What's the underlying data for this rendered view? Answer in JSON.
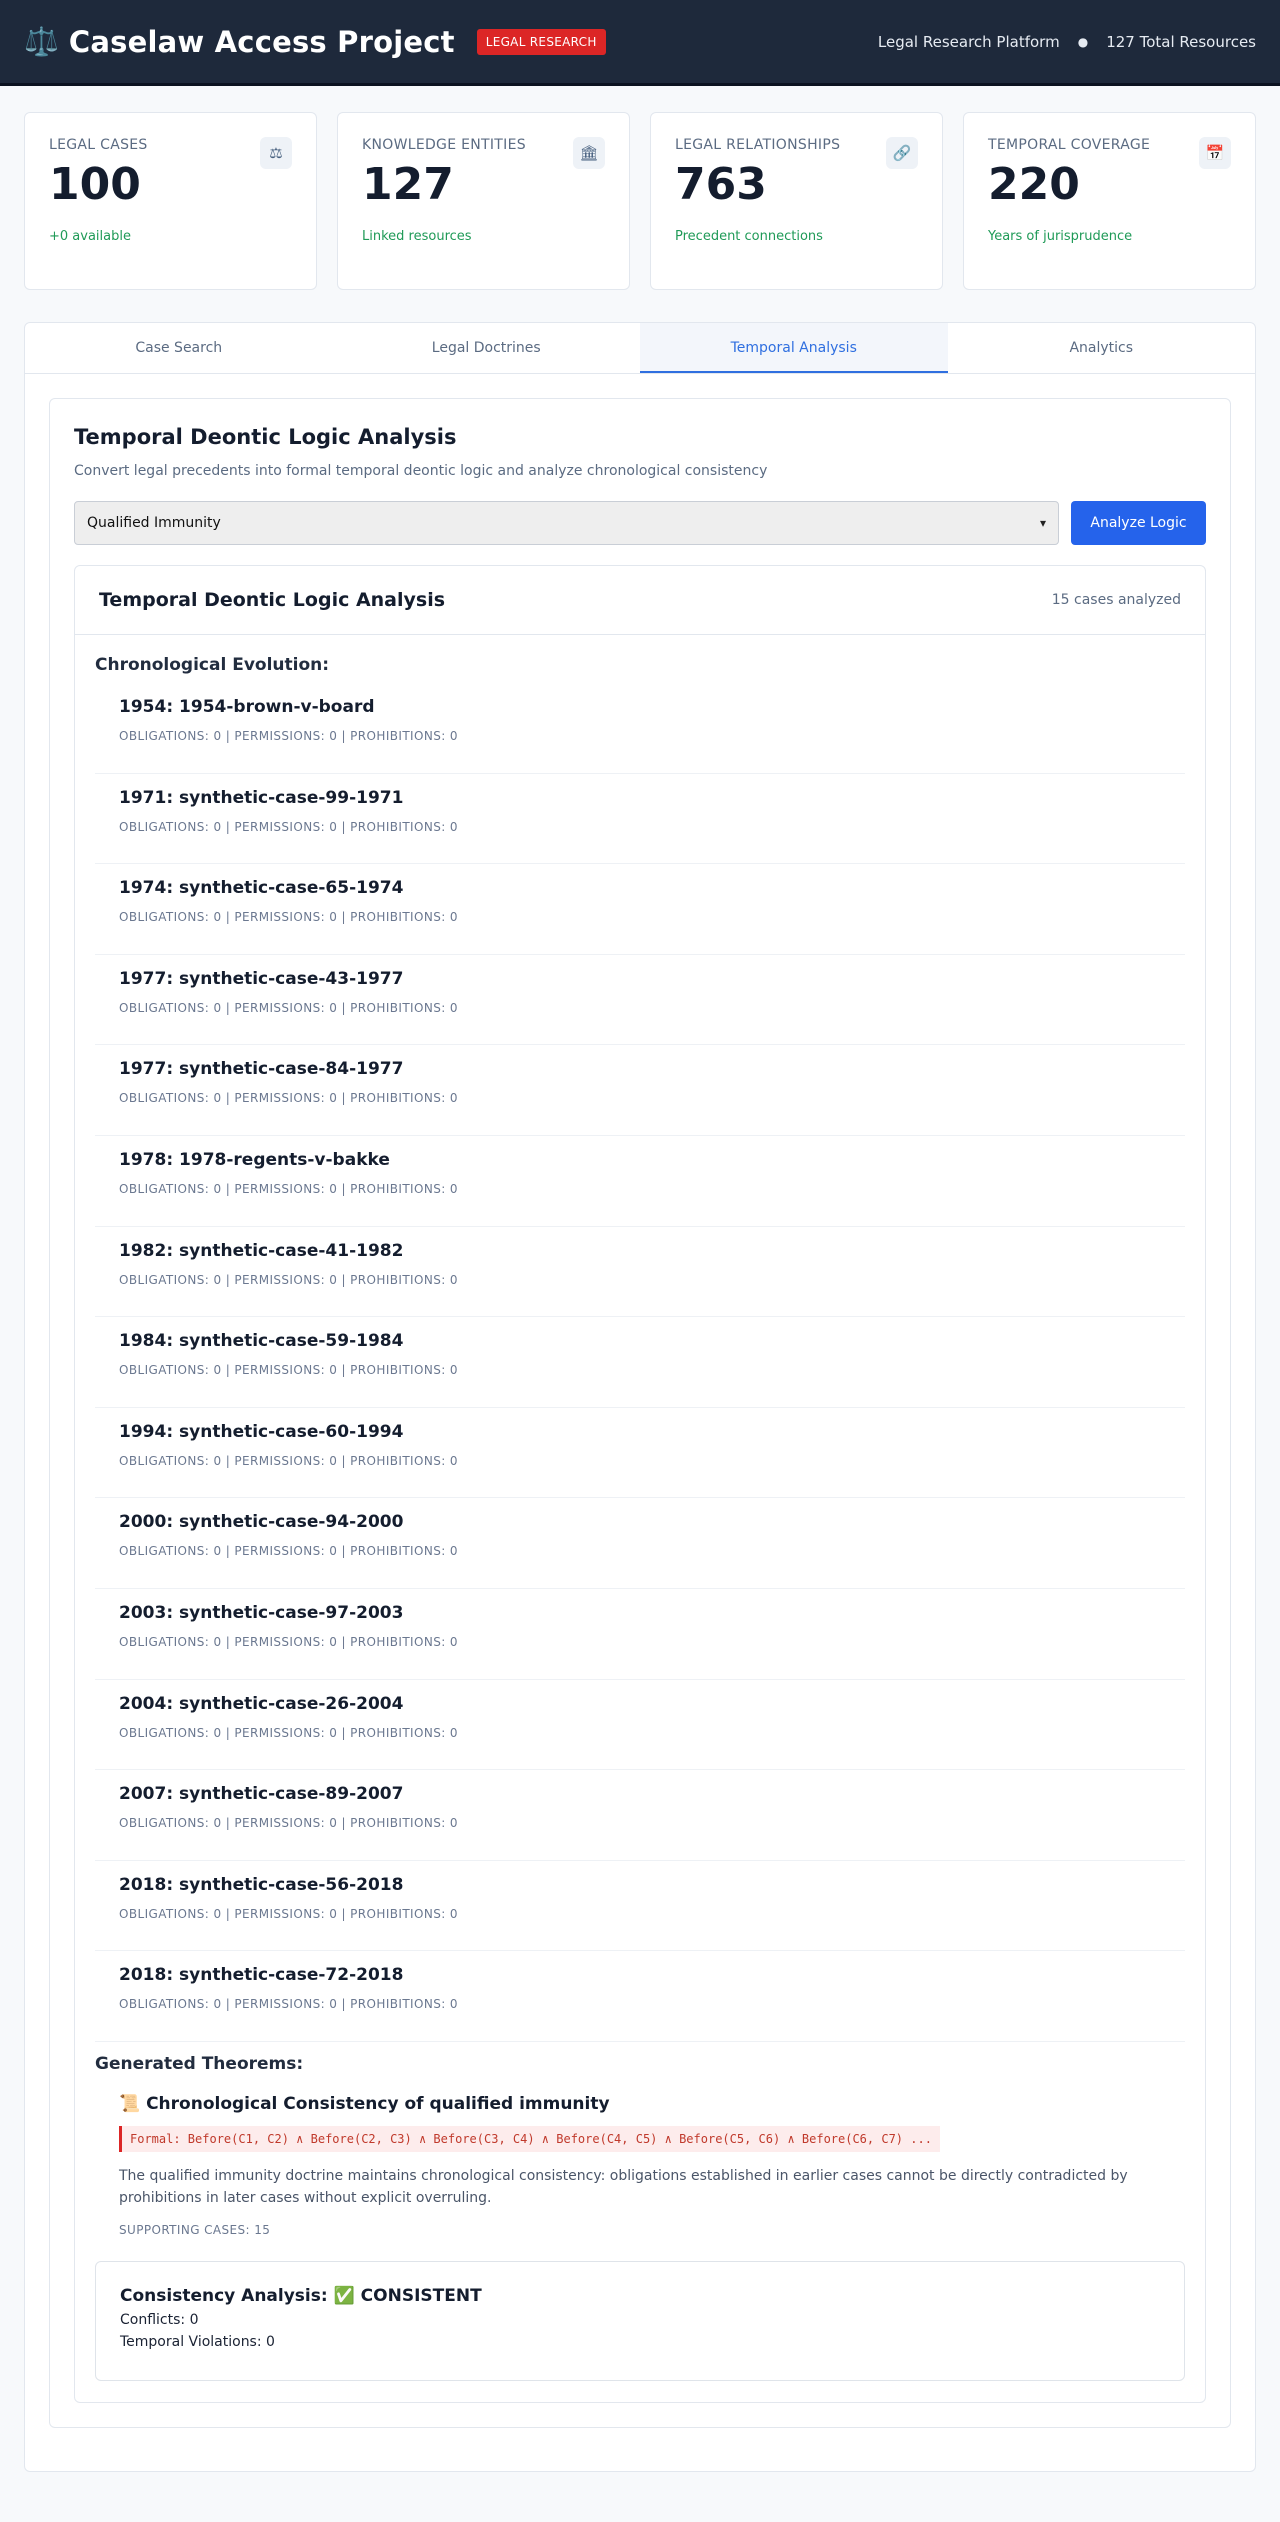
{
  "header": {
    "title": "Caselaw Access Project",
    "badge": "LEGAL RESEARCH",
    "platform": "Legal Research Platform",
    "resources": "127 Total Resources",
    "icon": "scales-icon"
  },
  "stats": [
    {
      "label": "LEGAL CASES",
      "value": "100",
      "sub": "+0 available",
      "icon": "⚖"
    },
    {
      "label": "KNOWLEDGE ENTITIES",
      "value": "127",
      "sub": "Linked resources",
      "icon": "🏛"
    },
    {
      "label": "LEGAL RELATIONSHIPS",
      "value": "763",
      "sub": "Precedent connections",
      "icon": "🔗"
    },
    {
      "label": "TEMPORAL COVERAGE",
      "value": "220",
      "sub": "Years of jurisprudence",
      "icon": "📅"
    }
  ],
  "tabs": [
    "Case Search",
    "Legal Doctrines",
    "Temporal Analysis",
    "Analytics"
  ],
  "active_tab": "Temporal Analysis",
  "analysis": {
    "title": "Temporal Deontic Logic Analysis",
    "description": "Convert legal precedents into formal temporal deontic logic and analyze chronological consistency",
    "select_value": "Qualified Immunity",
    "button": "Analyze Logic"
  },
  "result": {
    "title": "Temporal Deontic Logic Analysis",
    "count": "15 cases analyzed",
    "evolution_heading": "Chronological Evolution:",
    "evolution": [
      {
        "title": "1954: 1954-brown-v-board",
        "meta": "OBLIGATIONS: 0 | PERMISSIONS: 0 | PROHIBITIONS: 0"
      },
      {
        "title": "1971: synthetic-case-99-1971",
        "meta": "OBLIGATIONS: 0 | PERMISSIONS: 0 | PROHIBITIONS: 0"
      },
      {
        "title": "1974: synthetic-case-65-1974",
        "meta": "OBLIGATIONS: 0 | PERMISSIONS: 0 | PROHIBITIONS: 0"
      },
      {
        "title": "1977: synthetic-case-43-1977",
        "meta": "OBLIGATIONS: 0 | PERMISSIONS: 0 | PROHIBITIONS: 0"
      },
      {
        "title": "1977: synthetic-case-84-1977",
        "meta": "OBLIGATIONS: 0 | PERMISSIONS: 0 | PROHIBITIONS: 0"
      },
      {
        "title": "1978: 1978-regents-v-bakke",
        "meta": "OBLIGATIONS: 0 | PERMISSIONS: 0 | PROHIBITIONS: 0"
      },
      {
        "title": "1982: synthetic-case-41-1982",
        "meta": "OBLIGATIONS: 0 | PERMISSIONS: 0 | PROHIBITIONS: 0"
      },
      {
        "title": "1984: synthetic-case-59-1984",
        "meta": "OBLIGATIONS: 0 | PERMISSIONS: 0 | PROHIBITIONS: 0"
      },
      {
        "title": "1994: synthetic-case-60-1994",
        "meta": "OBLIGATIONS: 0 | PERMISSIONS: 0 | PROHIBITIONS: 0"
      },
      {
        "title": "2000: synthetic-case-94-2000",
        "meta": "OBLIGATIONS: 0 | PERMISSIONS: 0 | PROHIBITIONS: 0"
      },
      {
        "title": "2003: synthetic-case-97-2003",
        "meta": "OBLIGATIONS: 0 | PERMISSIONS: 0 | PROHIBITIONS: 0"
      },
      {
        "title": "2004: synthetic-case-26-2004",
        "meta": "OBLIGATIONS: 0 | PERMISSIONS: 0 | PROHIBITIONS: 0"
      },
      {
        "title": "2007: synthetic-case-89-2007",
        "meta": "OBLIGATIONS: 0 | PERMISSIONS: 0 | PROHIBITIONS: 0"
      },
      {
        "title": "2018: synthetic-case-56-2018",
        "meta": "OBLIGATIONS: 0 | PERMISSIONS: 0 | PROHIBITIONS: 0"
      },
      {
        "title": "2018: synthetic-case-72-2018",
        "meta": "OBLIGATIONS: 0 | PERMISSIONS: 0 | PROHIBITIONS: 0"
      }
    ],
    "theorems_heading": "Generated Theorems:",
    "theorem": {
      "title": "📜 Chronological Consistency of qualified immunity",
      "formal": "Formal: Before(C1, C2) ∧ Before(C2, C3) ∧ Before(C3, C4) ∧ Before(C4, C5) ∧ Before(C5, C6) ∧ Before(C6, C7) ...",
      "description": "The qualified immunity doctrine maintains chronological consistency: obligations established in earlier cases cannot be directly contradicted by prohibitions in later cases without explicit overruling.",
      "supporting": "SUPPORTING CASES: 15"
    },
    "consistency": {
      "title": "Consistency Analysis: ✅ CONSISTENT",
      "conflicts": "Conflicts: 0",
      "violations": "Temporal Violations: 0"
    }
  }
}
